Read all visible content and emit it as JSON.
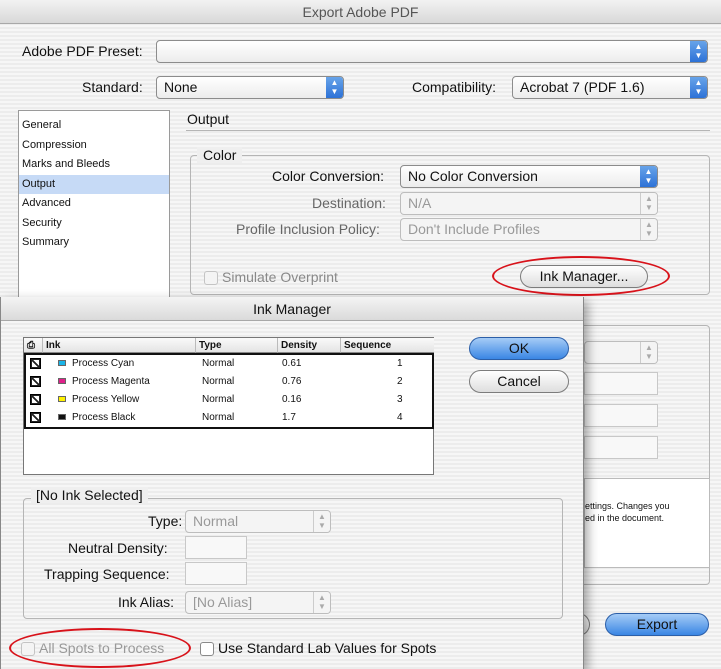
{
  "window": {
    "title": "Export Adobe PDF"
  },
  "preset": {
    "label": "Adobe PDF Preset:",
    "value": ""
  },
  "standard": {
    "label": "Standard:",
    "value": "None"
  },
  "compatibility": {
    "label": "Compatibility:",
    "value": "Acrobat 7 (PDF 1.6)"
  },
  "sidebar": {
    "items": [
      {
        "label": "General"
      },
      {
        "label": "Compression"
      },
      {
        "label": "Marks and Bleeds"
      },
      {
        "label": "Output"
      },
      {
        "label": "Advanced"
      },
      {
        "label": "Security"
      },
      {
        "label": "Summary"
      }
    ],
    "selected": "Output"
  },
  "output": {
    "title": "Output",
    "color_group": "Color",
    "color_conversion_label": "Color Conversion:",
    "color_conversion_value": "No Color Conversion",
    "destination_label": "Destination:",
    "destination_value": "N/A",
    "profile_label": "Profile Inclusion Policy:",
    "profile_value": "Don't Include Profiles",
    "simulate_overprint": "Simulate Overprint",
    "ink_manager_button": "Ink Manager...",
    "description_line1": "ettings. Changes you",
    "description_line2": "ed in the document.",
    "export_button": "Export"
  },
  "ink_manager": {
    "title": "Ink Manager",
    "columns": [
      "Ink",
      "Type",
      "Density",
      "Sequence"
    ],
    "inks": [
      {
        "name": "Process Cyan",
        "type": "Normal",
        "density": "0.61",
        "sequence": "1",
        "color": "#19b4e8"
      },
      {
        "name": "Process Magenta",
        "type": "Normal",
        "density": "0.76",
        "sequence": "2",
        "color": "#e0208a"
      },
      {
        "name": "Process Yellow",
        "type": "Normal",
        "density": "0.16",
        "sequence": "3",
        "color": "#fff200"
      },
      {
        "name": "Process Black",
        "type": "Normal",
        "density": "1.7",
        "sequence": "4",
        "color": "#111111"
      }
    ],
    "ok_button": "OK",
    "cancel_button": "Cancel",
    "selection_group": "[No Ink Selected]",
    "type_label": "Type:",
    "type_value": "Normal",
    "neutral_density_label": "Neutral Density:",
    "trapping_sequence_label": "Trapping Sequence:",
    "ink_alias_label": "Ink Alias:",
    "ink_alias_value": "[No Alias]",
    "all_spots_to_process": "All Spots to Process",
    "use_standard_lab": "Use Standard Lab Values for Spots"
  },
  "colors": {
    "accent": "#3a86e4",
    "highlight_oval": "#d8121a",
    "selection": "#c6daf6"
  }
}
